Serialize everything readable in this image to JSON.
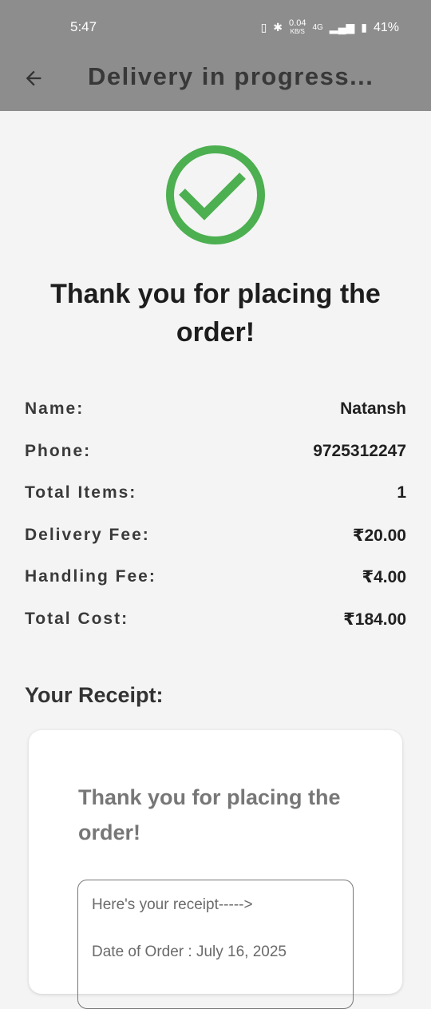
{
  "status_bar": {
    "time": "5:47",
    "data_speed": "0.04",
    "data_unit": "KB/S",
    "network": "4G",
    "battery": "41%"
  },
  "app_bar": {
    "title": "Delivery in progress..."
  },
  "confirmation": {
    "heading": "Thank you for placing the order!",
    "accent_color": "#4caf50"
  },
  "order_details": [
    {
      "label": "Name:",
      "value": "Natansh"
    },
    {
      "label": "Phone:",
      "value": "9725312247"
    },
    {
      "label": "Total Items:",
      "value": "1"
    },
    {
      "label": "Delivery Fee:",
      "value": "₹20.00"
    },
    {
      "label": "Handling Fee:",
      "value": "₹4.00"
    },
    {
      "label": "Total Cost:",
      "value": "₹184.00"
    }
  ],
  "receipt": {
    "section_title": "Your Receipt:",
    "card_title": "Thank you for placing the order!",
    "line_1": "Here's your receipt----->",
    "line_2": "Date of Order : July 16, 2025"
  }
}
